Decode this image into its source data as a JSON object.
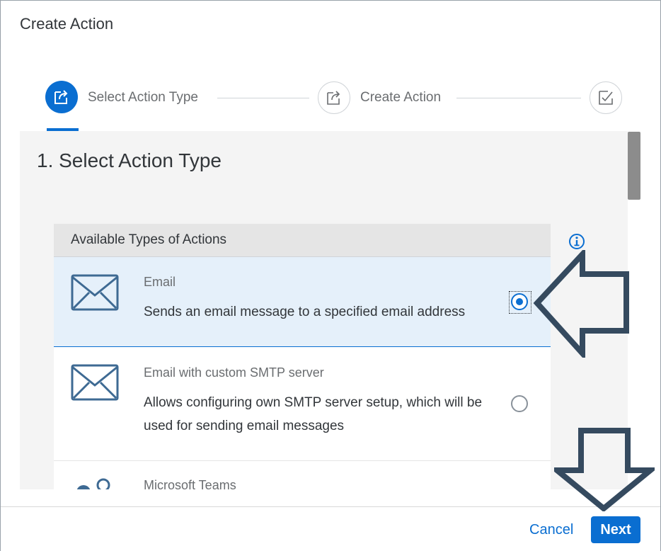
{
  "dialog": {
    "title": "Create Action"
  },
  "wizard": {
    "steps": [
      {
        "label": "Select Action Type",
        "state": "active",
        "icon": "export-icon"
      },
      {
        "label": "Create Action",
        "state": "inactive",
        "icon": "export-icon"
      },
      {
        "label": "",
        "state": "inactive",
        "icon": "checkbox-check-icon"
      }
    ]
  },
  "content": {
    "section_title": "1. Select Action Type",
    "table_header": "Available Types of Actions",
    "info_icon": "info-icon",
    "rows": [
      {
        "icon": "envelope-icon",
        "title": "Email",
        "description": "Sends an email message to a specified email address",
        "selected": true
      },
      {
        "icon": "envelope-icon",
        "title": "Email with custom SMTP server",
        "description": "Allows configuring own SMTP server setup, which will be used for sending email messages",
        "selected": false
      },
      {
        "icon": "teams-icon",
        "title": "Microsoft Teams",
        "description": "",
        "selected": false
      }
    ]
  },
  "footer": {
    "cancel_label": "Cancel",
    "next_label": "Next"
  },
  "colors": {
    "accent": "#0a6ed1",
    "selected_row": "#e5f0fa",
    "annotation_arrow": "#354a5f"
  }
}
